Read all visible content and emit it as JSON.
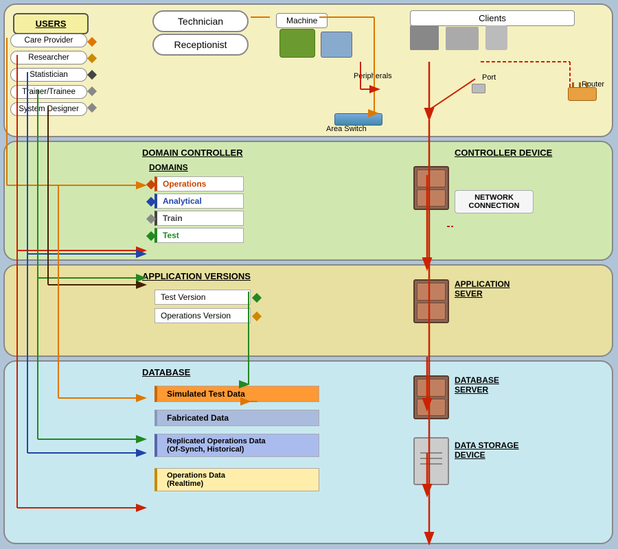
{
  "sections": {
    "users": {
      "title": "USERS",
      "users_list": [
        "Care Provider",
        "Researcher",
        "Statistician",
        "Trainer/Trainee",
        "System Designer"
      ],
      "roles": [
        "Technician",
        "Receptionist"
      ],
      "machine_label": "Machine",
      "clients_label": "Clients",
      "peripherals_label": "Peripherals",
      "port_label": "Port",
      "router_label": "Router",
      "area_switch_label": "Area Switch"
    },
    "domain": {
      "title": "DOMAIN CONTROLLER",
      "domains_label": "DOMAINS",
      "domains": [
        "Operations",
        "Analytical",
        "Train",
        "Test"
      ],
      "controller_device_label": "CONTROLLER DEVICE",
      "network_connection_label": "NETWORK\nCONNECTION"
    },
    "app": {
      "title": "APPLICATION VERSIONS",
      "versions": [
        "Test Version",
        "Operations Version"
      ],
      "server_label": "APPLICATION\nSEVER"
    },
    "database": {
      "title": "DATABASE",
      "items": [
        "Simulated Test Data",
        "Fabricated Data",
        "Replicated Operations Data\n(Of-Synch, Historical)",
        "Operations Data\n(Realtime)"
      ],
      "db_server_label": "DATABASE\nSERVER",
      "storage_label": "DATA STORAGE\nDEVICE"
    }
  },
  "colors": {
    "section1_bg": "#f5f0c0",
    "section2_bg": "#d4e8b0",
    "section3_bg": "#e8e0a0",
    "section4_bg": "#c8e8f0",
    "arrow_red": "#cc2200",
    "arrow_orange": "#dd7700",
    "arrow_green": "#228822",
    "arrow_blue": "#2244aa",
    "arrow_dark": "#331100",
    "domain_ops": "#cc4400",
    "domain_anal": "#2244aa",
    "domain_train": "#444444",
    "domain_test": "#228822",
    "db_simtest": "#ff8820",
    "db_fabricated": "#88aadd",
    "db_replicated": "#5566aa",
    "db_ops": "#cc3300"
  }
}
